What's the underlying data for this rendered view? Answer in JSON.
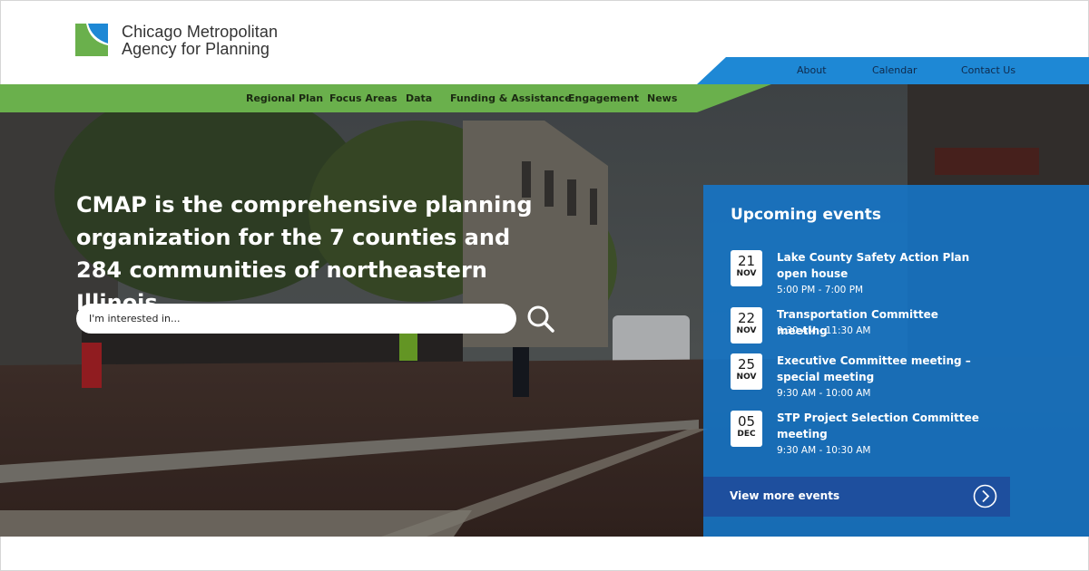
{
  "brand": {
    "line1": "Chicago Metropolitan",
    "line2": "Agency for Planning",
    "colors": {
      "green": "#6ab04c",
      "blue": "#1e88d5",
      "navy": "#1e4f9e"
    }
  },
  "utility_nav": [
    "About",
    "Calendar",
    "Contact Us"
  ],
  "main_nav": [
    "Regional Plan",
    "Focus Areas",
    "Data",
    "Funding & Assistance",
    "Engagement",
    "News"
  ],
  "hero": {
    "title": "CMAP is the comprehensive planning organization for the 7 counties and 284 communities of northeastern Illinois.",
    "search_placeholder": "I'm interested in...",
    "search_icon": "search-icon"
  },
  "events": {
    "title": "Upcoming events",
    "items": [
      {
        "day": "21",
        "month": "NOV",
        "name": "Lake County Safety Action Plan open house",
        "time": "5:00 PM - 7:00 PM"
      },
      {
        "day": "22",
        "month": "NOV",
        "name": "Transportation Committee meeting",
        "time": "9:30 AM - 11:30 AM"
      },
      {
        "day": "25",
        "month": "NOV",
        "name": "Executive Committee meeting – special meeting",
        "time": "9:30 AM - 10:00 AM"
      },
      {
        "day": "05",
        "month": "DEC",
        "name": "STP Project Selection Committee meeting",
        "time": "9:30 AM - 10:30 AM"
      }
    ],
    "more_label": "View more events",
    "more_icon": "chevron-right-circle-icon"
  }
}
